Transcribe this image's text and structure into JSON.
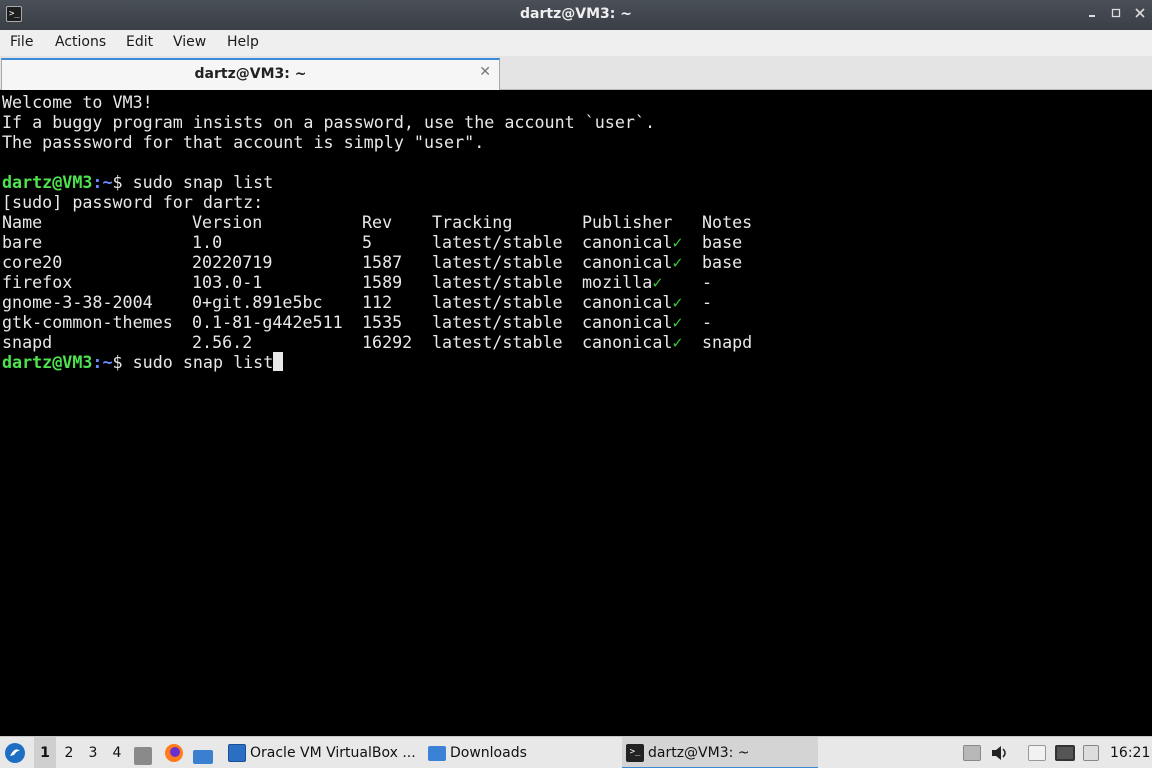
{
  "window": {
    "title": "dartz@VM3: ~",
    "icon": "terminal-icon",
    "controls": {
      "minimize": "▫",
      "maximize": "▫",
      "close": "✕"
    }
  },
  "menu": [
    "File",
    "Actions",
    "Edit",
    "View",
    "Help"
  ],
  "tab": {
    "label": "dartz@VM3: ~",
    "close": "✕"
  },
  "terminal": {
    "motd": [
      "Welcome to VM3!",
      "If a buggy program insists on a password, use the account `user`.",
      "The passsword for that account is simply \"user\"."
    ],
    "prompt_user": "dartz@VM3",
    "prompt_path": ":~",
    "prompt_symbol": "$ ",
    "command1": "sudo snap list",
    "sudo_prompt": "[sudo] password for dartz:",
    "table": {
      "headers": [
        "Name",
        "Version",
        "Rev",
        "Tracking",
        "Publisher",
        "Notes"
      ],
      "rows": [
        {
          "name": "bare",
          "version": "1.0",
          "rev": "5",
          "tracking": "latest/stable",
          "publisher": "canonical",
          "verified": "✓",
          "notes": "base"
        },
        {
          "name": "core20",
          "version": "20220719",
          "rev": "1587",
          "tracking": "latest/stable",
          "publisher": "canonical",
          "verified": "✓",
          "notes": "base"
        },
        {
          "name": "firefox",
          "version": "103.0-1",
          "rev": "1589",
          "tracking": "latest/stable",
          "publisher": "mozilla",
          "verified": "✓",
          "notes": "-"
        },
        {
          "name": "gnome-3-38-2004",
          "version": "0+git.891e5bc",
          "rev": "112",
          "tracking": "latest/stable",
          "publisher": "canonical",
          "verified": "✓",
          "notes": "-"
        },
        {
          "name": "gtk-common-themes",
          "version": "0.1-81-g442e511",
          "rev": "1535",
          "tracking": "latest/stable",
          "publisher": "canonical",
          "verified": "✓",
          "notes": "-"
        },
        {
          "name": "snapd",
          "version": "2.56.2",
          "rev": "16292",
          "tracking": "latest/stable",
          "publisher": "canonical",
          "verified": "✓",
          "notes": "snapd"
        }
      ]
    },
    "command2": "sudo snap list"
  },
  "taskbar": {
    "workspaces": [
      "1",
      "2",
      "3",
      "4"
    ],
    "tasks": [
      {
        "label": "Oracle VM VirtualBox ...",
        "icon": "virtualbox-icon"
      },
      {
        "label": "Downloads",
        "icon": "folder-icon"
      },
      {
        "label": "dartz@VM3: ~",
        "icon": "terminal-icon"
      }
    ],
    "clock": "16:21"
  },
  "colors": {
    "prompt_user": "#4ee34e",
    "prompt_path": "#6a8cff",
    "accent": "#3b8ad8"
  }
}
